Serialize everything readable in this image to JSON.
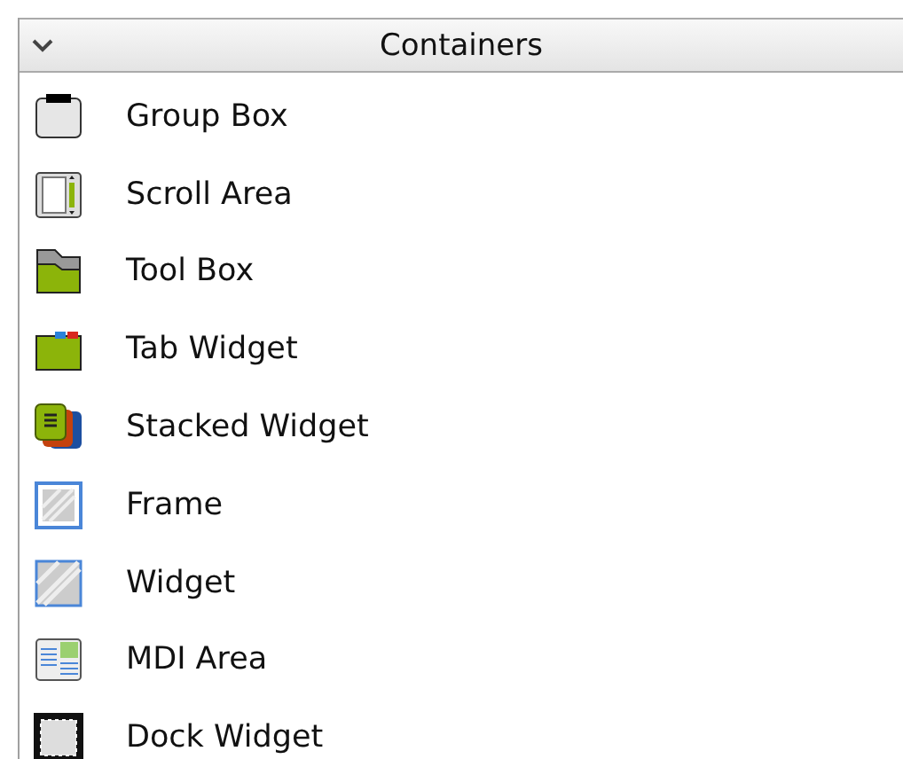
{
  "category": {
    "title": "Containers",
    "expanded": true
  },
  "items": [
    {
      "label": "Group Box"
    },
    {
      "label": "Scroll Area"
    },
    {
      "label": "Tool Box"
    },
    {
      "label": "Tab Widget"
    },
    {
      "label": "Stacked Widget"
    },
    {
      "label": "Frame"
    },
    {
      "label": "Widget"
    },
    {
      "label": "MDI Area"
    },
    {
      "label": "Dock Widget"
    }
  ]
}
